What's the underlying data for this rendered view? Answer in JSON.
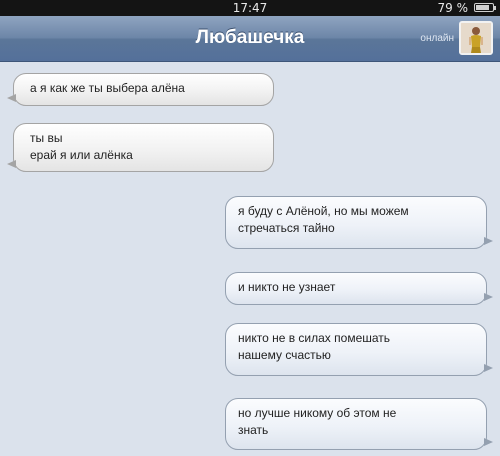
{
  "status_bar": {
    "time": "17:47",
    "battery": "79 %",
    "battery_level": 0.79
  },
  "header": {
    "contact_name": "Любашечка",
    "status": "онлайн",
    "avatar_icon": "user-avatar-photo"
  },
  "messages": [
    {
      "direction": "incoming",
      "lines": [
        "а я как же ты выбера алёна"
      ]
    },
    {
      "direction": "incoming",
      "lines": [
        "ты вы",
        "ерай я или алёнка"
      ]
    },
    {
      "direction": "outgoing",
      "lines": [
        "я буду с Алёной, но мы можем",
        "стречаться тайно"
      ]
    },
    {
      "direction": "outgoing",
      "lines": [
        "и никто не узнает"
      ]
    },
    {
      "direction": "outgoing",
      "lines": [
        "никто не в силах помешать",
        "нашему счастью"
      ]
    },
    {
      "direction": "outgoing",
      "lines": [
        "но лучше никому об этом не",
        "знать"
      ]
    }
  ],
  "colors": {
    "nav_bar": "#6d86a8",
    "chat_background": "#dbe2ec",
    "status_bar": "#141414"
  }
}
